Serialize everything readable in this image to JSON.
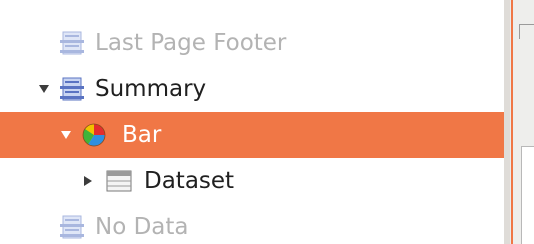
{
  "tree": {
    "items": [
      {
        "label": "Last Page Footer",
        "state": "disabled",
        "icon": "band-icon",
        "arrow": "none"
      },
      {
        "label": "Summary",
        "state": "normal",
        "icon": "band-icon",
        "arrow": "expanded"
      },
      {
        "label": "Bar",
        "state": "selected",
        "icon": "pie-chart-icon",
        "arrow": "expanded"
      },
      {
        "label": "Dataset",
        "state": "normal",
        "icon": "dataset-icon",
        "arrow": "collapsed"
      },
      {
        "label": "No Data",
        "state": "disabled",
        "icon": "band-icon",
        "arrow": "none"
      }
    ]
  },
  "colors": {
    "selection": "#f07746",
    "text": "#202020",
    "disabled_text": "#b3b3b3",
    "band_icon": "#5a73c2",
    "background": "#ffffff"
  }
}
